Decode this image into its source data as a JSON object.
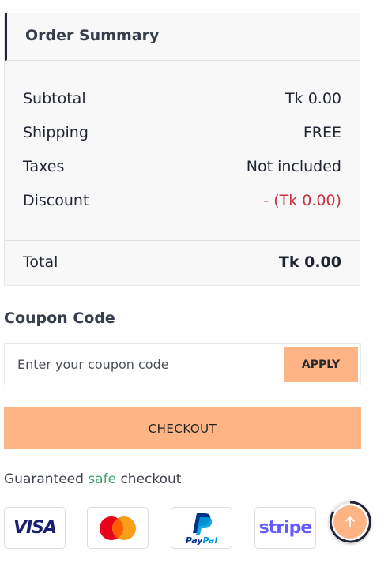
{
  "summary": {
    "title": "Order Summary",
    "rows": [
      {
        "label": "Subtotal",
        "value": "Tk 0.00"
      },
      {
        "label": "Shipping",
        "value": "FREE"
      },
      {
        "label": "Taxes",
        "value": "Not included"
      },
      {
        "label": "Discount",
        "value": "- (Tk 0.00)"
      }
    ],
    "total_label": "Total",
    "total_value": "Tk 0.00",
    "discount_color": "#c7323d"
  },
  "coupon": {
    "title": "Coupon Code",
    "placeholder": "Enter your coupon code",
    "apply_label": "APPLY"
  },
  "checkout": {
    "label": "CHECKOUT"
  },
  "guarantee": {
    "prefix": "Guaranteed ",
    "highlight": "safe",
    "suffix": " checkout"
  },
  "payment_methods": [
    {
      "name": "VISA",
      "icon": "visa-icon"
    },
    {
      "name": "Mastercard",
      "icon": "mastercard-icon"
    },
    {
      "name": "PayPal",
      "icon": "paypal-icon"
    },
    {
      "name": "stripe",
      "icon": "stripe-icon"
    }
  ],
  "scroll_top": {
    "icon": "arrow-up-icon"
  },
  "colors": {
    "accent": "#ffb486",
    "safe_green": "#3aa66e",
    "text_dark": "#1f2533"
  }
}
